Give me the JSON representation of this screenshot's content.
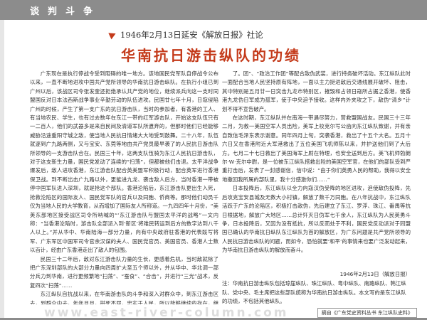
{
  "header": {
    "section_title": "谈判斗争"
  },
  "kicker": "1946年2月13日延安《解放日报》社论",
  "headline": "华南抗日游击纵队的功绩",
  "left_paragraphs": [
    "广东现在是执行停战令受到阻碍的唯一地方。该地国民党军队自停战令公布以来，一直不断地进攻中国共产党所领导的华南抗日游击纵队。在执行小组已到广州以后，该战区司令张发奎还拒绝承认共产党的地位，继续派兵向这一支时同盟国反对日本法西斯战争事业辛勤劳动的队伍进攻。民国廿七年十月，日寇侵陷广州的时候，产生了第一支广东的抗日游击队，当时的参加者，有香港的工人、有当地农民、学生，也有过去数年在东江一带的红军游击队，开始这支队伍只有一二百人，他们的武器多是来自民间及清道军队所遗弃的，但那时他们已经能够威胁沿途重阳守城之敌，使当地人民抗日情绪大大地受到鼓舞。二十八年，队伍就逐到广九路两侧，又与宝安、东莞等地由共产党员最早袭了的人民抗日游击队所领导的一支游击队合在。民国三十年，这两支队伍骑为东江人民抗日游击队，对于这支新生力量，国民党发动了连续的“扫荡”，但都被他们击退。太平洋战争爆发后，敌人进攻香港，东江游击队配合英美盟军积极行动，配合英军进行香港保卫战。到不断出击广九路以外，更能进九龙、袭击敌人后方，当时香港一带被停中国军队进入深圳，就是抢这个部队。香港沦陷后，东江游击队更出生入死，抢救沦陷区的国际友人、国民党军队的官兵以及同胞、侨商等。那时他们动员千仅为当地人民的大学教育，从而增加了国际友人所称道。一九四四年十月份，“美英东部地区接受战区司令所呐喊的“‘东江游击队与盟国太平洋的战略”一文内称：“当香港沦陷时，游击队全部派入到‘新区’将难民转运到后方的数字达到八千人以上。”并从华中、华南陆海一部分力量，向有中央政府驻香港的代表既写将军、广东军区中国军司令官余汉谋的夫人、国民党官员、美国官员、香港人士数以百计，经由广东香港走出了敌人的包围。",
    "民国三十二年后，敌对东江游击队力量的生长，更感着危机，当时敌就除了把广东深圳部队的大部分力量向四周扩大至五个师以外，并从华中、华北调一部分兵力到华南，进行更频繁地“扫荡”、“蚕食”、“合击”，并进行“三光”战术，反复四次“扫荡”……",
    "东江纵队自抗战以来，在华南游击队的斗争和深入对群众中，到东江游击区去，到群众中去。年年月月，拼死不屈，忠实于人民，所以能够继续的存在，继续有力量发展起来，而对日寇给予巨大打击。"
  ],
  "right_paragraphs": [
    "了。团”、“政治工作团”等配合敌伪武装，进行持务破坏活动。东江纵队此时一面配合当地人民坚持原有阵地，一面以主力挺进敌后交通线展开破坏、阻击，其中特别是五月廿一日突击九龙市特别区，摧毁和占领日寇所占据之香港，使香港九龙伪日军成为孤军，使于中央迫予接收。这样内外夹攻之下，敌伪“清乡”计划不得不宣告破产。",
    "在这时期，东江纵队并在南海一带遇尽努力，营救盟国战友。民国三十三年二月，为救一美国空军人员出险，美军上校克尔写公函向东江纵队致谢，并有亲自致信毛泽东表示谢意。同年四月上旬，突袭香港，救出了十五个大名。五月十六日又在香港附近大军港救出了五位美国飞机师陈以来，并护送他们到了大后方。七月二十七日救出了美国海军上尉在特理，也安全送到后方。美飞机师勃朗尔·W·克尔中尉，是一位被东江纵队搭救出险的美国空军官，在他们的部队受到严重打击后，发表了一封感谢信，信中说：“由于你们英勇人民的帮助，我得以安全地撤回我所属的部队里，我十分感激你们……”",
    "日本投降后，东江纵队以全力向寇汉伪受降的地区进攻，迫使敌伪投降，先后攻克宝安县城及无数大小村镇，解放了数千万同胞。在八年抗战中，东江纵队活跃于广东的沦陷区，积极打击敌伪，先后建立了东江、罗浮、珠江、番禺等抗日根据地，解放广大地区……总计歼灭日伪军七千余人，东江纵队为人民英勇斗争，日本投降后，又因为没有抵抗，所以反而处于不利，国民党反动派对于同盟国已确认的华南抗日纵队东江纵队为首的解放区，为广东问题是共产党所领导的人民抗日游击纵队的问题，而如今，恐怕就要‘和平’的事情来也要广泛发动起来，为华南抗日游击纵队的解放而奋斗。"
  ],
  "note": {
    "date_line": "1946年2月13日（解放日报）",
    "annotation": "注：华南抗日游击纵队包括琼崖纵队、珠江纵队、粤中纵队、南路纵队、韩江纵队、党中央、毛主席把这些部队统称为华南抗日游击纵队。本文写的是东江纵队的功绩，不包括其他纵队。"
  },
  "footer": {
    "watermark": "www.east-river-column.com",
    "source": "摘自《广东党史资料丛书 东江纵队史料》"
  }
}
